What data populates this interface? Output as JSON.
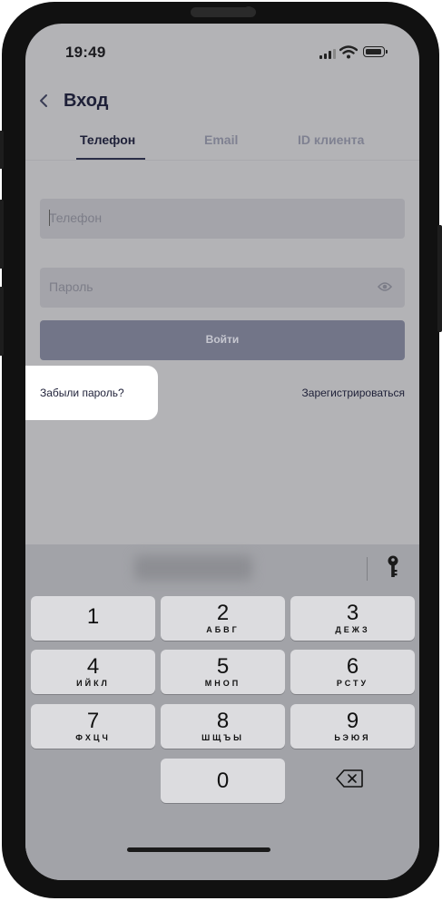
{
  "status": {
    "time": "19:49"
  },
  "header": {
    "back_icon": "chevron-left-icon",
    "title": "Вход"
  },
  "tabs": [
    {
      "label": "Телефон",
      "active": true
    },
    {
      "label": "Email",
      "active": false
    },
    {
      "label": "ID клиента",
      "active": false
    }
  ],
  "form": {
    "phone_placeholder": "Телефон",
    "password_placeholder": "Пароль",
    "login_label": "Войти",
    "forgot_label": "Забыли пароль?",
    "register_label": "Зарегистрироваться"
  },
  "keyboard": {
    "keys": [
      {
        "digit": "1",
        "letters": ""
      },
      {
        "digit": "2",
        "letters": "АБВГ"
      },
      {
        "digit": "3",
        "letters": "ДЕЖЗ"
      },
      {
        "digit": "4",
        "letters": "ИЙКЛ"
      },
      {
        "digit": "5",
        "letters": "МНОП"
      },
      {
        "digit": "6",
        "letters": "РСТУ"
      },
      {
        "digit": "7",
        "letters": "ФХЦЧ"
      },
      {
        "digit": "8",
        "letters": "ШЩЪЫ"
      },
      {
        "digit": "9",
        "letters": "ЬЭЮЯ"
      },
      {
        "digit": "0",
        "letters": ""
      }
    ]
  },
  "colors": {
    "accent": "#1e2038",
    "button": "#727588",
    "overlay": "#b3b3b6"
  }
}
